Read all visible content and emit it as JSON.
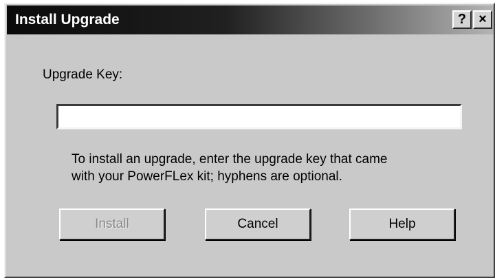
{
  "window": {
    "title": "Install Upgrade",
    "help_button": "?",
    "close_button": "×"
  },
  "form": {
    "key_label": "Upgrade Key:",
    "key_value": "",
    "hint_line1": "To install an upgrade, enter the upgrade key that came",
    "hint_line2": "with your PowerFLex kit; hyphens are optional."
  },
  "buttons": {
    "install": {
      "label": "Install",
      "enabled": false
    },
    "cancel": {
      "label": "Cancel",
      "enabled": true
    },
    "help": {
      "label": "Help",
      "enabled": true
    }
  },
  "colors": {
    "dialog_background": "#c9c9c9",
    "titlebar_start": "#0a0a0a",
    "titlebar_end": "#b4b4b4",
    "disabled_text": "#8a8a8a"
  }
}
